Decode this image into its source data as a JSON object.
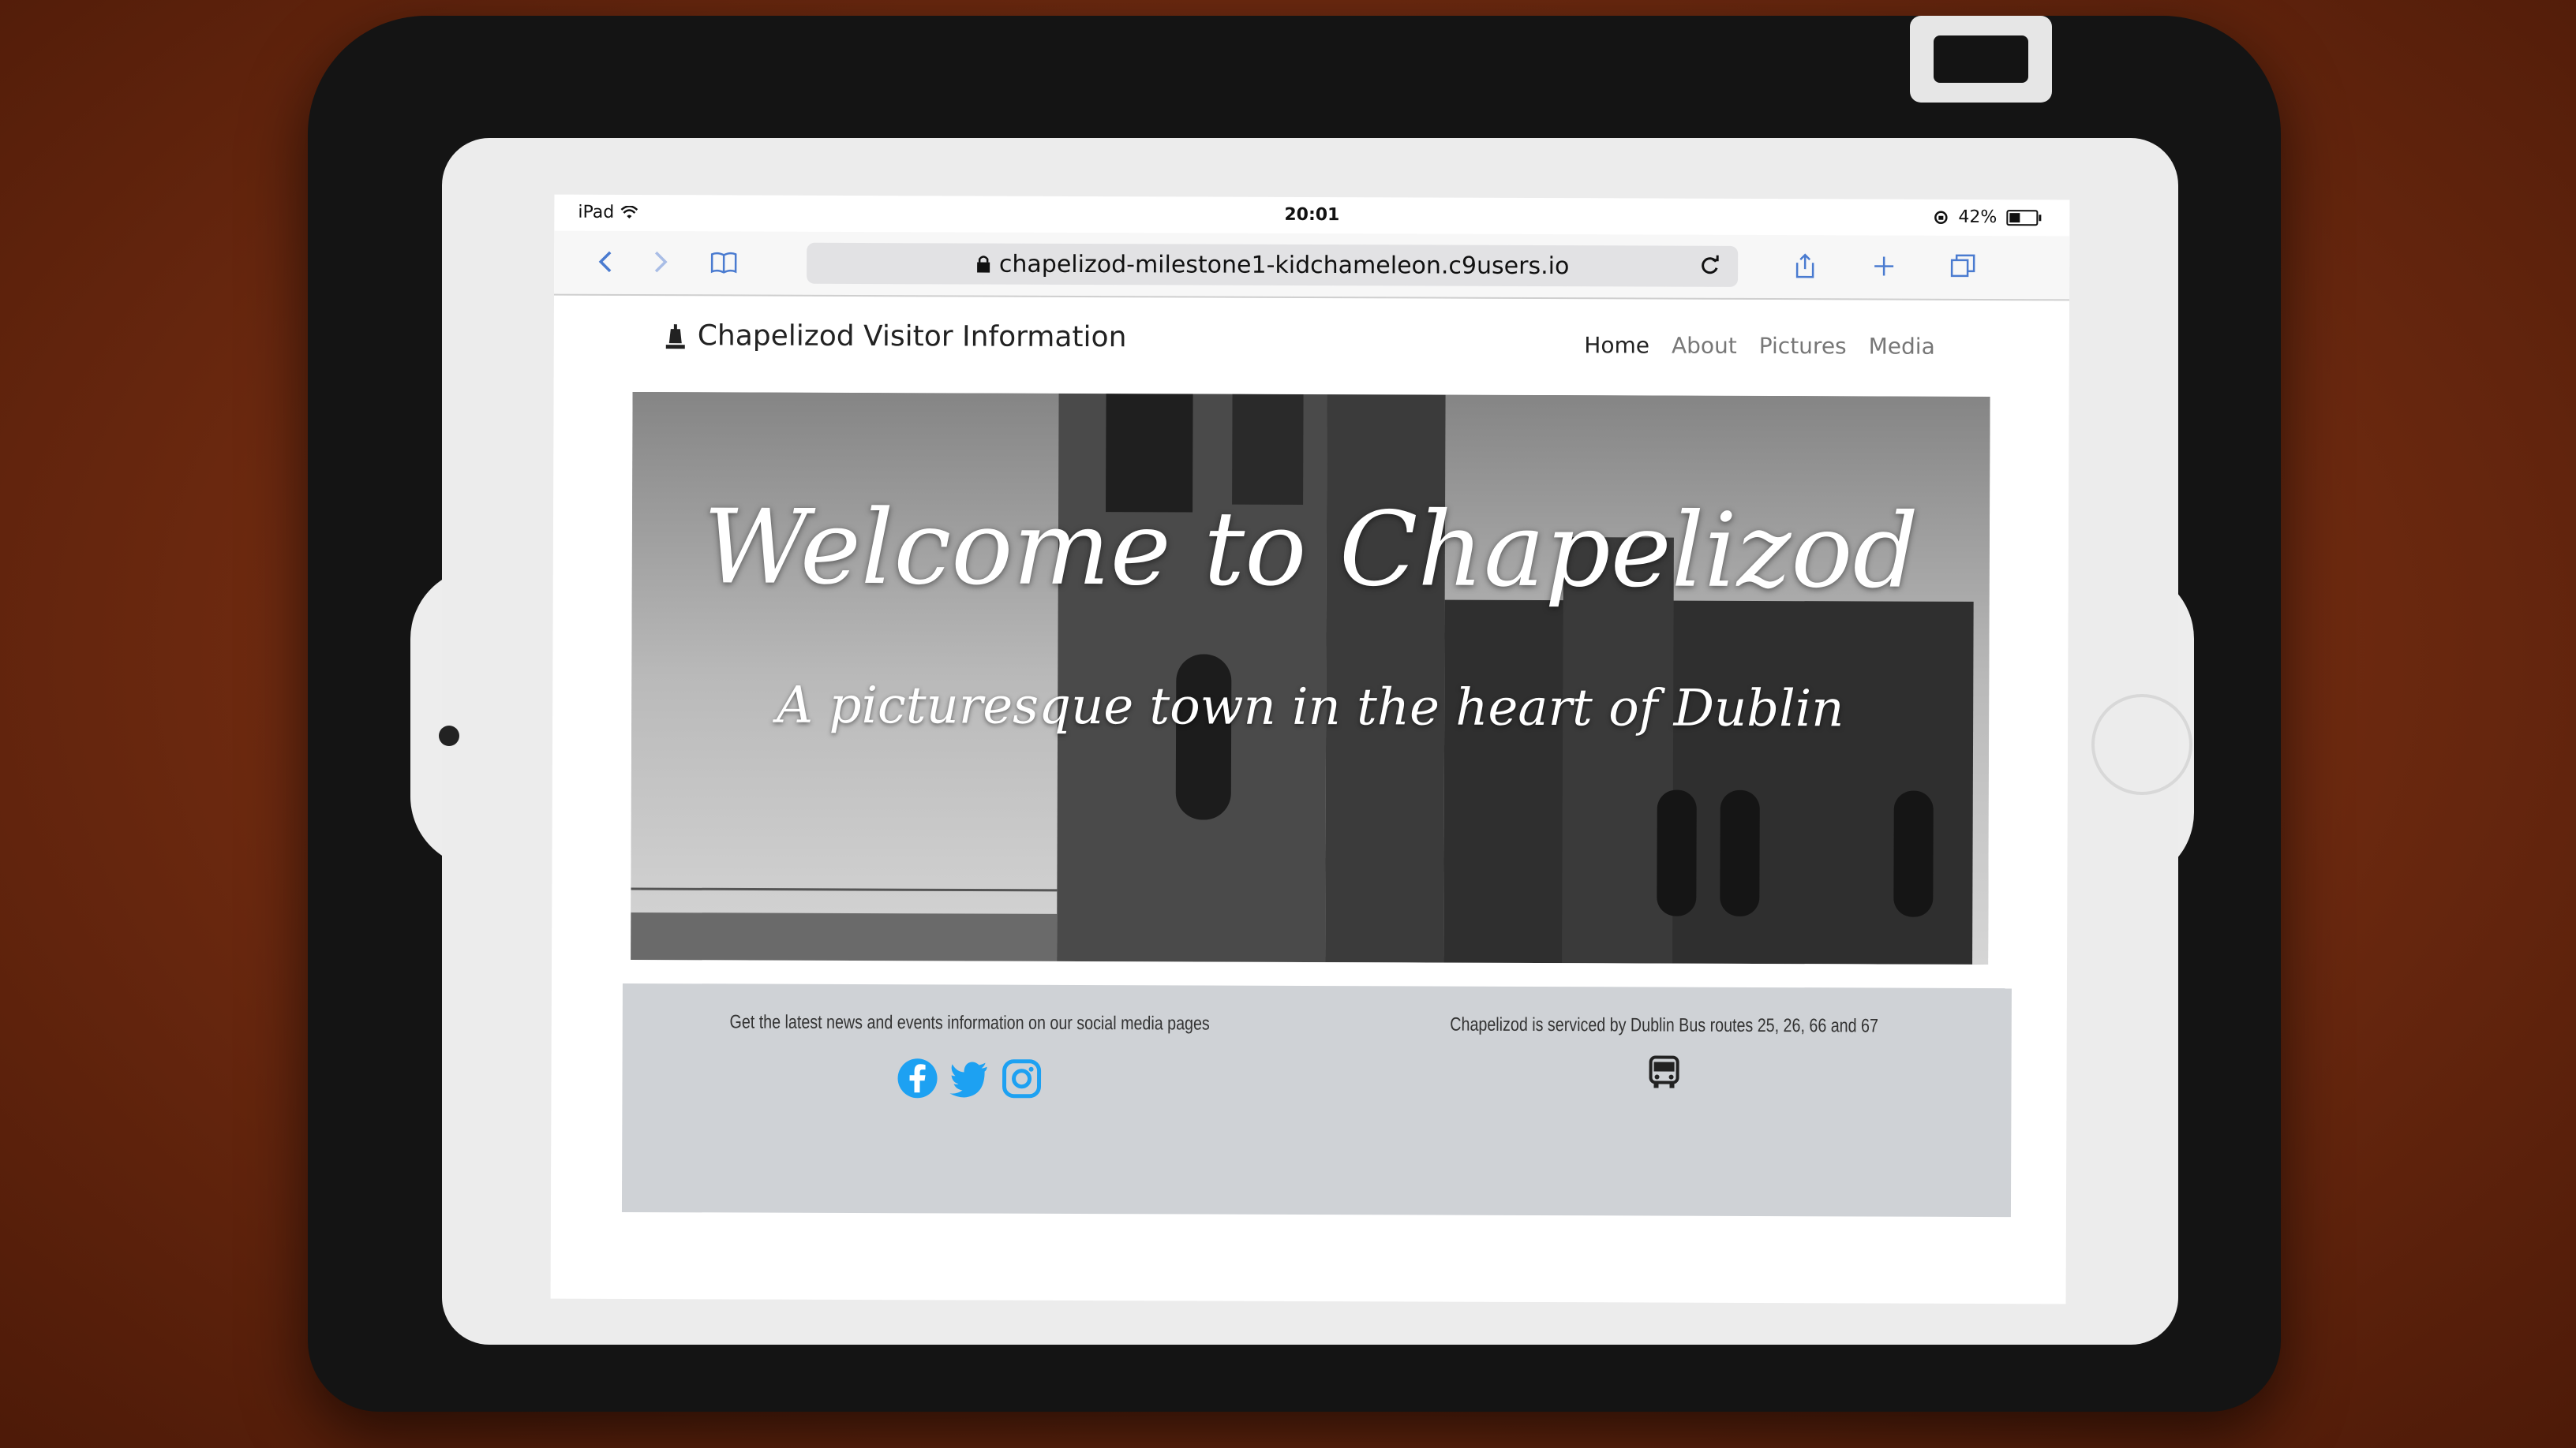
{
  "status_bar": {
    "device": "iPad",
    "time": "20:01",
    "battery": "42%",
    "battery_level": 0.42
  },
  "browser": {
    "url": "chapelizod-milestone1-kidchameleon.c9users.io",
    "icons": [
      "back-icon",
      "forward-icon",
      "bookmarks-icon",
      "lock-icon",
      "reload-icon",
      "share-icon",
      "new-tab-icon",
      "tabs-icon"
    ]
  },
  "site": {
    "brand": "Chapelizod Visitor Information",
    "nav": [
      "Home",
      "About",
      "Pictures",
      "Media"
    ],
    "active_nav": "Home"
  },
  "hero": {
    "title": "Welcome to Chapelizod",
    "subtitle": "A picturesque town in the heart of Dublin"
  },
  "footer": {
    "social_text": "Get the latest news and events information on our social media pages",
    "social_icons": [
      "facebook-icon",
      "twitter-icon",
      "instagram-icon"
    ],
    "social_color": "#1da1f2",
    "bus_text": "Chapelizod is serviced by Dublin Bus routes 25, 26, 66 and 67",
    "bus_icon": "bus-icon"
  }
}
